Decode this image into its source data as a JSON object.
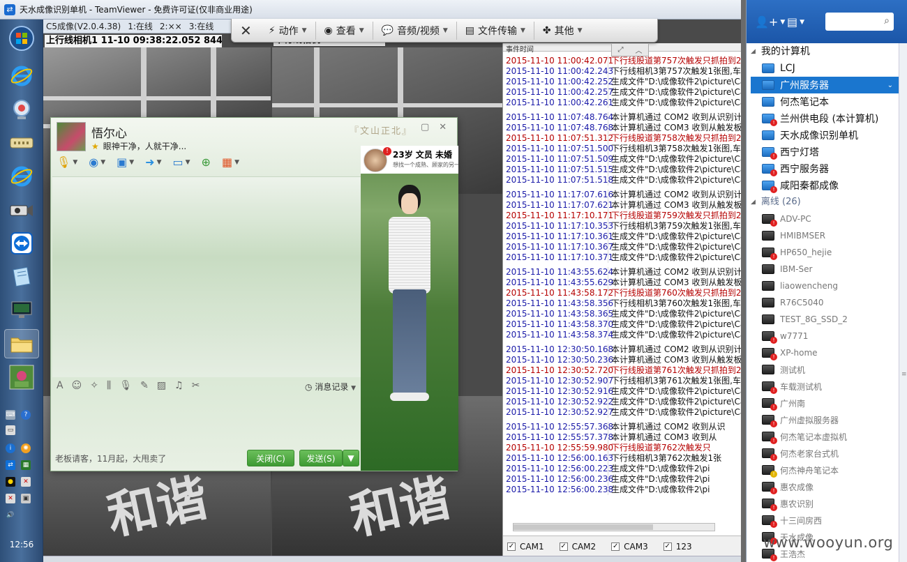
{
  "window": {
    "title": "天水成像识别单机 - TeamViewer - 免费许可证(仅非商业用途)",
    "logo_icon": "teamviewer-logo-icon"
  },
  "taskbar": {
    "clock": "12:56",
    "icons": [
      "windows-start-icon",
      "ie-icon",
      "webcam-icon",
      "network-icon",
      "ie-icon",
      "camera-icon",
      "teamviewer-icon",
      "notepad-icon",
      "monitor-icon",
      "folder-icon",
      "qq-avatar-icon"
    ]
  },
  "c5": {
    "version": "C5成像(V2.0.4.38)",
    "cam1_status": "1:在线",
    "cam2_status": "2:××",
    "cam3_status": "3:在线",
    "cam1_title": "上行线相机1    11-10 09:38:22.052 844",
    "cam2_title": "下行线相机"
  },
  "tv_toolbar": {
    "action": "动作",
    "view": "查看",
    "audio_video": "音频/视频",
    "file_transfer": "文件传输",
    "other": "其他"
  },
  "log": {
    "header": "事件时间",
    "groups": [
      [
        {
          "ts": "2015-11-10 11:00:42.071",
          "msg": "下行线股道第757次触发只抓拍到2张",
          "red": true
        },
        {
          "ts": "2015-11-10 11:00:42.243",
          "msg": "下行线相机3第757次触发1张图,车号",
          "red": false
        },
        {
          "ts": "2015-11-10 11:00:42.252",
          "msg": "生成文件\"D:\\成像软件2\\picture\\Ca",
          "red": false
        },
        {
          "ts": "2015-11-10 11:00:42.257",
          "msg": "生成文件\"D:\\成像软件2\\picture\\Ca",
          "red": false
        },
        {
          "ts": "2015-11-10 11:00:42.261",
          "msg": "生成文件\"D:\\成像软件2\\picture\\Ca",
          "red": false
        }
      ],
      [
        {
          "ts": "2015-11-10 11:07:48.764",
          "msg": "本计算机通过 COM2 收到从识别计",
          "red": false
        },
        {
          "ts": "2015-11-10 11:07:48.768",
          "msg": "本计算机通过 COM3 收到从触发板",
          "red": false
        },
        {
          "ts": "2015-11-10 11:07:51.312",
          "msg": "下行线股道第758次触发只抓拍到2张",
          "red": true
        },
        {
          "ts": "2015-11-10 11:07:51.500",
          "msg": "下行线相机3第758次触发1张图,车号",
          "red": false
        },
        {
          "ts": "2015-11-10 11:07:51.509",
          "msg": "生成文件\"D:\\成像软件2\\picture\\Ca",
          "red": false
        },
        {
          "ts": "2015-11-10 11:07:51.515",
          "msg": "生成文件\"D:\\成像软件2\\picture\\Ca",
          "red": false
        },
        {
          "ts": "2015-11-10 11:07:51.518",
          "msg": "生成文件\"D:\\成像软件2\\picture\\Ca",
          "red": false
        }
      ],
      [
        {
          "ts": "2015-11-10 11:17:07.616",
          "msg": "本计算机通过 COM2 收到从识别计",
          "red": false
        },
        {
          "ts": "2015-11-10 11:17:07.621",
          "msg": "本计算机通过 COM3 收到从触发板",
          "red": false
        },
        {
          "ts": "2015-11-10 11:17:10.171",
          "msg": "下行线股道第759次触发只抓拍到2张",
          "red": true
        },
        {
          "ts": "2015-11-10 11:17:10.353",
          "msg": "下行线相机3第759次触发1张图,车号",
          "red": false
        },
        {
          "ts": "2015-11-10 11:17:10.361",
          "msg": "生成文件\"D:\\成像软件2\\picture\\Ca",
          "red": false
        },
        {
          "ts": "2015-11-10 11:17:10.367",
          "msg": "生成文件\"D:\\成像软件2\\picture\\Ca",
          "red": false
        },
        {
          "ts": "2015-11-10 11:17:10.371",
          "msg": "生成文件\"D:\\成像软件2\\picture\\Ca",
          "red": false
        }
      ],
      [
        {
          "ts": "2015-11-10 11:43:55.624",
          "msg": "本计算机通过 COM2 收到从识别计",
          "red": false
        },
        {
          "ts": "2015-11-10 11:43:55.629",
          "msg": "本计算机通过 COM3 收到从触发板",
          "red": false
        },
        {
          "ts": "2015-11-10 11:43:58.172",
          "msg": "下行线股道第760次触发只抓拍到2张",
          "red": true
        },
        {
          "ts": "2015-11-10 11:43:58.356",
          "msg": "下行线相机3第760次触发1张图,车号",
          "red": false
        },
        {
          "ts": "2015-11-10 11:43:58.365",
          "msg": "生成文件\"D:\\成像软件2\\picture\\Ca",
          "red": false
        },
        {
          "ts": "2015-11-10 11:43:58.370",
          "msg": "生成文件\"D:\\成像软件2\\picture\\Ca",
          "red": false
        },
        {
          "ts": "2015-11-10 11:43:58.374",
          "msg": "生成文件\"D:\\成像软件2\\picture\\Ca",
          "red": false
        }
      ],
      [
        {
          "ts": "2015-11-10 12:30:50.168",
          "msg": "本计算机通过 COM2 收到从识别计",
          "red": false
        },
        {
          "ts": "2015-11-10 12:30:50.236",
          "msg": "本计算机通过 COM3 收到从触发板",
          "red": false
        },
        {
          "ts": "2015-11-10 12:30:52.720",
          "msg": "下行线股道第761次触发只抓拍到2张",
          "red": true
        },
        {
          "ts": "2015-11-10 12:30:52.907",
          "msg": "下行线相机3第761次触发1张图,车号",
          "red": false
        },
        {
          "ts": "2015-11-10 12:30:52.916",
          "msg": "生成文件\"D:\\成像软件2\\picture\\Ca",
          "red": false
        },
        {
          "ts": "2015-11-10 12:30:52.922",
          "msg": "生成文件\"D:\\成像软件2\\picture\\Ca",
          "red": false
        },
        {
          "ts": "2015-11-10 12:30:52.927",
          "msg": "生成文件\"D:\\成像软件2\\picture\\Ca",
          "red": false
        }
      ],
      [
        {
          "ts": "2015-11-10 12:55:57.368",
          "msg": "本计算机通过 COM2 收到从识",
          "red": false
        },
        {
          "ts": "2015-11-10 12:55:57.378",
          "msg": "本计算机通过 COM3 收到从",
          "red": false
        },
        {
          "ts": "2015-11-10 12:55:59.980",
          "msg": "下行线股道第762次触发只",
          "red": true
        },
        {
          "ts": "2015-11-10 12:56:00.163",
          "msg": "下行线相机3第762次触发1张",
          "red": false
        },
        {
          "ts": "2015-11-10 12:56:00.223",
          "msg": "生成文件\"D:\\成像软件2\\pi",
          "red": false
        },
        {
          "ts": "2015-11-10 12:56:00.236",
          "msg": "生成文件\"D:\\成像软件2\\pi",
          "red": false
        },
        {
          "ts": "2015-11-10 12:56:00.238",
          "msg": "生成文件\"D:\\成像软件2\\pi",
          "red": false
        }
      ]
    ],
    "checkboxes": [
      "CAM1",
      "CAM2",
      "CAM3",
      "123"
    ]
  },
  "qq": {
    "name": "悟尔心",
    "signature": "眼神干净，人就干净...",
    "stamp": "『文山正北』",
    "history_label": "消息记录",
    "ad_text": "老板请客，11月起，大甩卖了",
    "close_label": "关闭(C)",
    "send_label": "发送(S)",
    "profile_title": "23岁 文员 未婚",
    "profile_desc": "想找一个成熟、顾家的另一半",
    "badge": "!"
  },
  "tv_panel": {
    "my_computers": "我的计算机",
    "online": [
      {
        "name": "LCJ",
        "warn": ""
      },
      {
        "name": "广州服务器",
        "warn": "",
        "selected": true
      },
      {
        "name": "何杰笔记本",
        "warn": ""
      },
      {
        "name": "兰州供电段 (本计算机)",
        "warn": "red"
      },
      {
        "name": "天水成像识别单机",
        "warn": ""
      },
      {
        "name": "西宁灯塔",
        "warn": "red"
      },
      {
        "name": "西宁服务器",
        "warn": "red"
      },
      {
        "name": "咸阳秦都成像",
        "warn": "red"
      }
    ],
    "offline_label": "离线 (26)",
    "offline": [
      {
        "name": "ADV-PC",
        "warn": "red"
      },
      {
        "name": "HMIBMSER",
        "warn": ""
      },
      {
        "name": "HP650_hejie",
        "warn": "red"
      },
      {
        "name": "IBM-Ser",
        "warn": ""
      },
      {
        "name": "liaowencheng",
        "warn": ""
      },
      {
        "name": "R76C5040",
        "warn": ""
      },
      {
        "name": "TEST_8G_SSD_2",
        "warn": ""
      },
      {
        "name": "w7771",
        "warn": "red"
      },
      {
        "name": "XP-home",
        "warn": "red"
      },
      {
        "name": "测试机",
        "warn": ""
      },
      {
        "name": "车载测试机",
        "warn": "red"
      },
      {
        "name": "广州南",
        "warn": "red"
      },
      {
        "name": "广州虚拟服务器",
        "warn": "red"
      },
      {
        "name": "何杰笔记本虚拟机",
        "warn": "red"
      },
      {
        "name": "何杰老家台式机",
        "warn": "red"
      },
      {
        "name": "何杰神舟笔记本",
        "warn": "yellow"
      },
      {
        "name": "惠农成像",
        "warn": "red"
      },
      {
        "name": "惠农识别",
        "warn": "red"
      },
      {
        "name": "十三间房西",
        "warn": "red"
      },
      {
        "name": "天水成像",
        "warn": "red"
      },
      {
        "name": "王浩杰",
        "warn": "red"
      }
    ]
  },
  "watermark": "www.wooyun.org"
}
